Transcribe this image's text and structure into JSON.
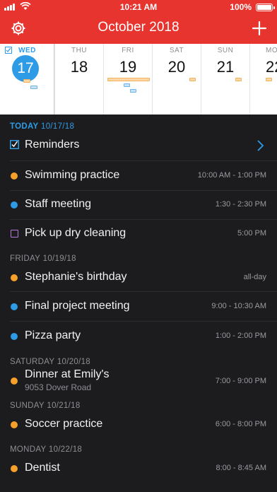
{
  "status": {
    "time": "10:21 AM",
    "battery": "100%"
  },
  "nav": {
    "title": "October 2018"
  },
  "week": [
    {
      "dow": "WED",
      "num": "17",
      "today": true
    },
    {
      "dow": "THU",
      "num": "18"
    },
    {
      "dow": "FRI",
      "num": "19"
    },
    {
      "dow": "SAT",
      "num": "20"
    },
    {
      "dow": "SUN",
      "num": "21"
    },
    {
      "dow": "MO",
      "num": "22"
    }
  ],
  "sections": {
    "today": {
      "label": "TODAY",
      "date": "10/17/18"
    },
    "friday": {
      "label": "FRIDAY",
      "date": "10/19/18"
    },
    "saturday": {
      "label": "SATURDAY",
      "date": "10/20/18"
    },
    "sunday": {
      "label": "SUNDAY",
      "date": "10/21/18"
    },
    "monday": {
      "label": "MONDAY",
      "date": "10/22/18"
    }
  },
  "events": {
    "reminders": {
      "title": "Reminders"
    },
    "swimming": {
      "title": "Swimming practice",
      "time": "10:00 AM - 1:00 PM",
      "color": "orange"
    },
    "staff": {
      "title": "Staff meeting",
      "time": "1:30 - 2:30 PM",
      "color": "blue"
    },
    "cleaning": {
      "title": "Pick up dry cleaning",
      "time": "5:00 PM",
      "color": "purple"
    },
    "birthday": {
      "title": "Stephanie's birthday",
      "time": "all-day",
      "color": "orange"
    },
    "project": {
      "title": "Final project meeting",
      "time": "9:00 - 10:30 AM",
      "color": "blue"
    },
    "pizza": {
      "title": "Pizza party",
      "time": "1:00 - 2:00 PM",
      "color": "blue"
    },
    "dinner": {
      "title": "Dinner at Emily's",
      "location": "9053 Dover Road",
      "time": "7:00 - 9:00 PM",
      "color": "orange"
    },
    "soccer": {
      "title": "Soccer practice",
      "time": "6:00 - 8:00 PM",
      "color": "orange"
    },
    "dentist": {
      "title": "Dentist",
      "time": "8:00 - 8:45 AM",
      "color": "orange"
    }
  },
  "colors": {
    "accent": "#e8342e",
    "today_blue": "#2e9be6",
    "event_orange": "#f7a02a",
    "task_purple": "#b07ad8"
  }
}
